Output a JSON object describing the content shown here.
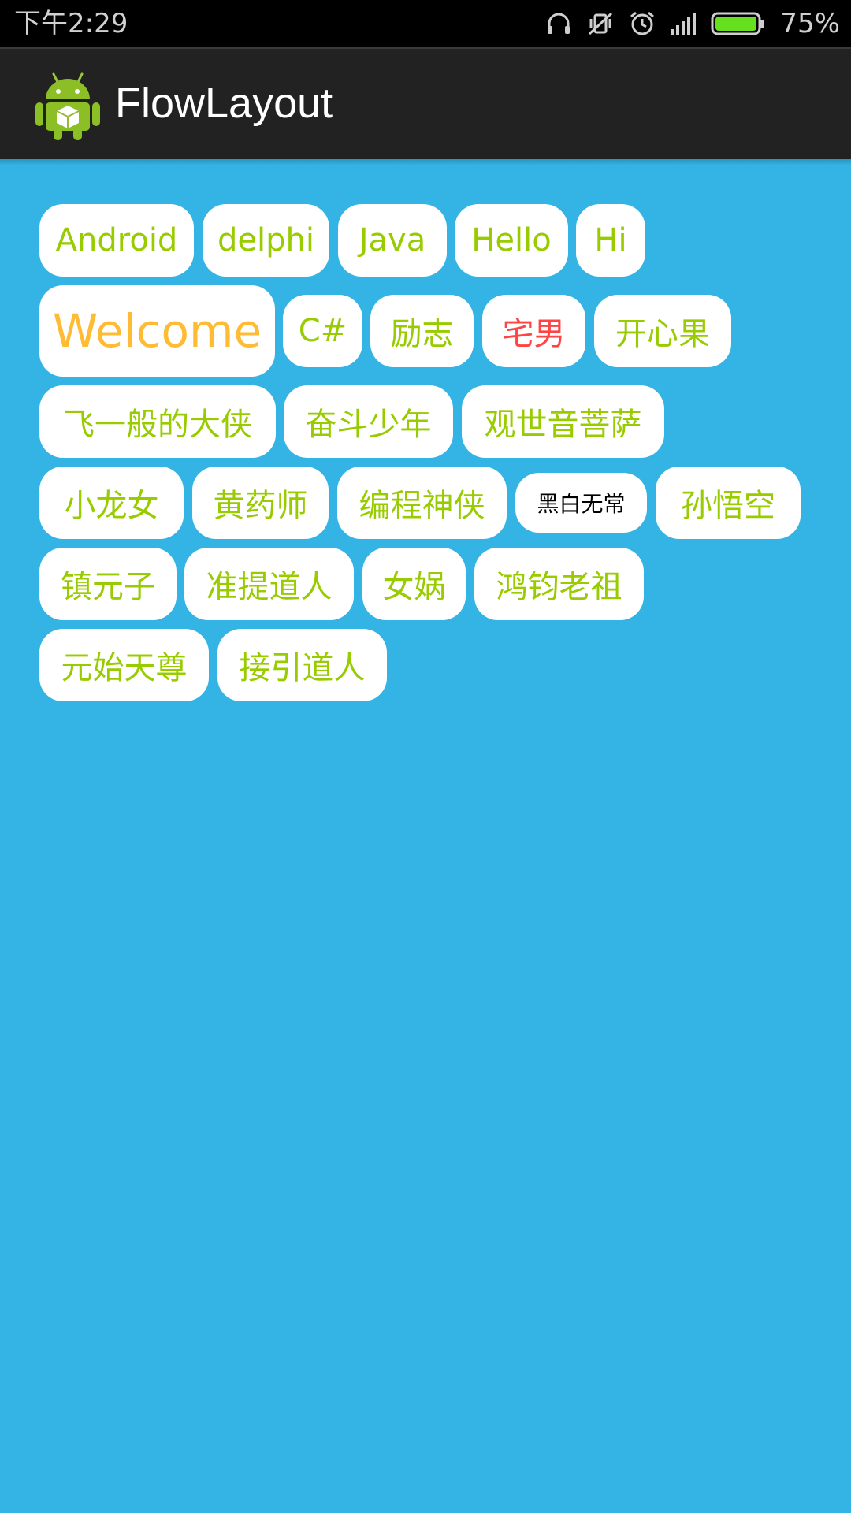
{
  "status_bar": {
    "time": "下午2:29",
    "battery_percent": "75%",
    "battery_level": 0.75,
    "icons": [
      "headphones-icon",
      "vibrate-off-icon",
      "alarm-icon",
      "signal-icon",
      "battery-icon"
    ]
  },
  "action_bar": {
    "app_icon": "android-robot-icon",
    "title": "FlowLayout"
  },
  "colors": {
    "background": "#34b4e5",
    "tag_text_default": "#99cc00",
    "tag_text_welcome": "#ffbb33",
    "tag_text_red": "#ff4444",
    "tag_text_black": "#000000",
    "tag_background": "#ffffff"
  },
  "tags": [
    {
      "label": "Android"
    },
    {
      "label": "delphi"
    },
    {
      "label": "Java"
    },
    {
      "label": "Hello"
    },
    {
      "label": "Hi"
    },
    {
      "label": "Welcome"
    },
    {
      "label": "C#"
    },
    {
      "label": "励志"
    },
    {
      "label": "宅男"
    },
    {
      "label": "开心果"
    },
    {
      "label": "飞一般的大侠"
    },
    {
      "label": "奋斗少年"
    },
    {
      "label": "观世音菩萨"
    },
    {
      "label": "小龙女"
    },
    {
      "label": "黄药师"
    },
    {
      "label": "编程神侠"
    },
    {
      "label": "黑白无常"
    },
    {
      "label": "孙悟空"
    },
    {
      "label": "镇元子"
    },
    {
      "label": "准提道人"
    },
    {
      "label": "女娲"
    },
    {
      "label": "鸿钧老祖"
    },
    {
      "label": "元始天尊"
    },
    {
      "label": "接引道人"
    }
  ]
}
